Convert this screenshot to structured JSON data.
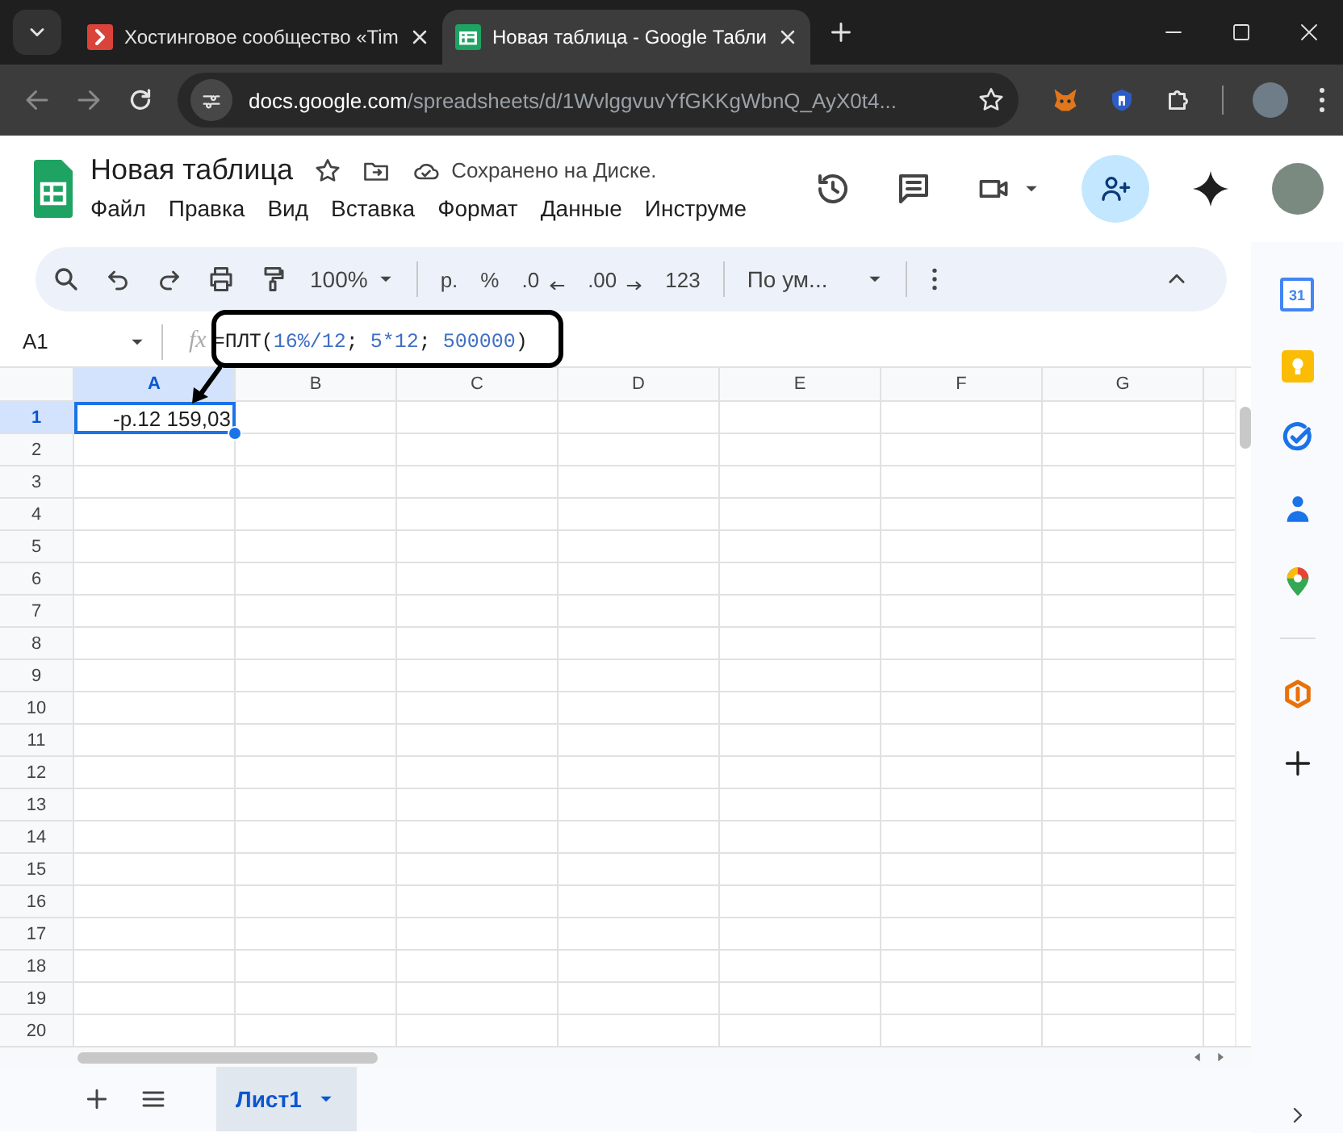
{
  "browser_tabs": [
    {
      "title": "Хостинговое сообщество «Tim",
      "kind": "hosting",
      "selected": false
    },
    {
      "title": "Новая таблица - Google Табли",
      "kind": "sheets",
      "selected": true
    }
  ],
  "address_bar": {
    "host": "docs.google.com",
    "path": "/spreadsheets/d/1WvlggvuvYfGKKgWbnQ_AyX0t4..."
  },
  "document": {
    "title": "Новая таблица",
    "save_status": "Сохранено на Диске."
  },
  "menus": [
    "Файл",
    "Правка",
    "Вид",
    "Вставка",
    "Формат",
    "Данные",
    "Инструме"
  ],
  "toolbar": {
    "zoom": "100%",
    "format_buttons": [
      {
        "label": "р.",
        "kind": "plain"
      },
      {
        "label": "%",
        "kind": "plain"
      },
      {
        "label": ".0",
        "kind": "decrease"
      },
      {
        "label": ".00",
        "kind": "increase"
      },
      {
        "label": "123",
        "kind": "plain"
      }
    ],
    "font": "По ум..."
  },
  "formula_bar": {
    "name_box": "A1",
    "function_label": "fx",
    "formula": [
      {
        "text": "=ПЛТ(",
        "kind": "text"
      },
      {
        "text": "16%/12",
        "kind": "number"
      },
      {
        "text": "; ",
        "kind": "text"
      },
      {
        "text": "5*12",
        "kind": "number"
      },
      {
        "text": "; ",
        "kind": "text"
      },
      {
        "text": "500000",
        "kind": "number"
      },
      {
        "text": ")",
        "kind": "text"
      }
    ]
  },
  "grid": {
    "columns": [
      {
        "label": "A",
        "selected": true
      },
      {
        "label": "B",
        "selected": false
      },
      {
        "label": "C",
        "selected": false
      },
      {
        "label": "D",
        "selected": false
      },
      {
        "label": "E",
        "selected": false
      },
      {
        "label": "F",
        "selected": false
      },
      {
        "label": "G",
        "selected": false
      }
    ],
    "rows": [
      {
        "label": "1",
        "selected": true,
        "cells": [
          {
            "value": "-р.12 159,03",
            "selected": true
          }
        ]
      },
      {
        "label": "2",
        "selected": false
      },
      {
        "label": "3",
        "selected": false
      },
      {
        "label": "4",
        "selected": false
      },
      {
        "label": "5",
        "selected": false
      },
      {
        "label": "6",
        "selected": false
      },
      {
        "label": "7",
        "selected": false
      },
      {
        "label": "8",
        "selected": false
      },
      {
        "label": "9",
        "selected": false
      },
      {
        "label": "10",
        "selected": false
      },
      {
        "label": "11",
        "selected": false
      },
      {
        "label": "12",
        "selected": false
      },
      {
        "label": "13",
        "selected": false
      },
      {
        "label": "14",
        "selected": false
      },
      {
        "label": "15",
        "selected": false
      },
      {
        "label": "16",
        "selected": false
      },
      {
        "label": "17",
        "selected": false
      },
      {
        "label": "18",
        "selected": false
      },
      {
        "label": "19",
        "selected": false
      },
      {
        "label": "20",
        "selected": false
      }
    ]
  },
  "side_panel": {
    "calendar_day": "31"
  },
  "sheet_tabs": [
    {
      "label": "Лист1",
      "selected": true
    }
  ]
}
